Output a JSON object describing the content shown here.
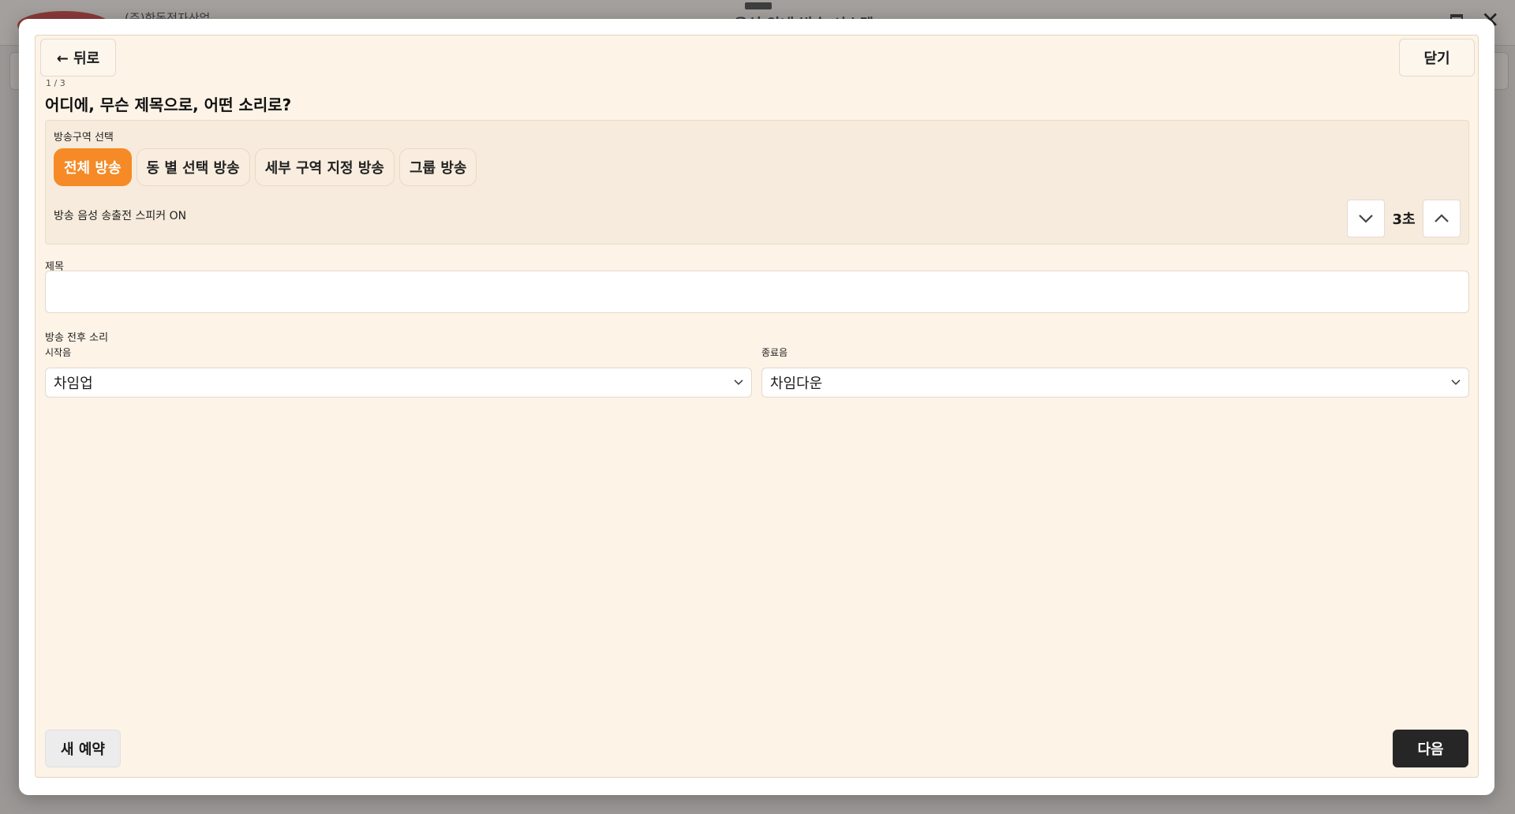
{
  "background": {
    "company": "(주)한동전자산업",
    "title": "음성 안내 방송 시스템"
  },
  "modal": {
    "back_label": "← 뒤로",
    "close_label": "닫기",
    "step": "1 / 3",
    "heading": "어디에, 무슨 제목으로, 어떤 소리로?",
    "zone": {
      "label": "방송구역 선택",
      "tabs": [
        {
          "label": "전체 방송",
          "active": true
        },
        {
          "label": "동 별 선택 방송",
          "active": false
        },
        {
          "label": "세부 구역 지정 방송",
          "active": false
        },
        {
          "label": "그룹 방송",
          "active": false
        }
      ],
      "speaker_label": "방송 음성 송출전 스피커 ON",
      "speaker_delay": "3초"
    },
    "title_field": {
      "label": "제목",
      "value": "",
      "placeholder": ""
    },
    "sound": {
      "label": "방송 전후 소리",
      "start_label": "시작음",
      "start_value": "차임업",
      "end_label": "종료음",
      "end_value": "차임다운"
    },
    "new_label": "새 예약",
    "next_label": "다음"
  },
  "colors": {
    "accent": "#f58a26",
    "panel_bg": "#fdf3e7",
    "primary_dark": "#262626"
  }
}
